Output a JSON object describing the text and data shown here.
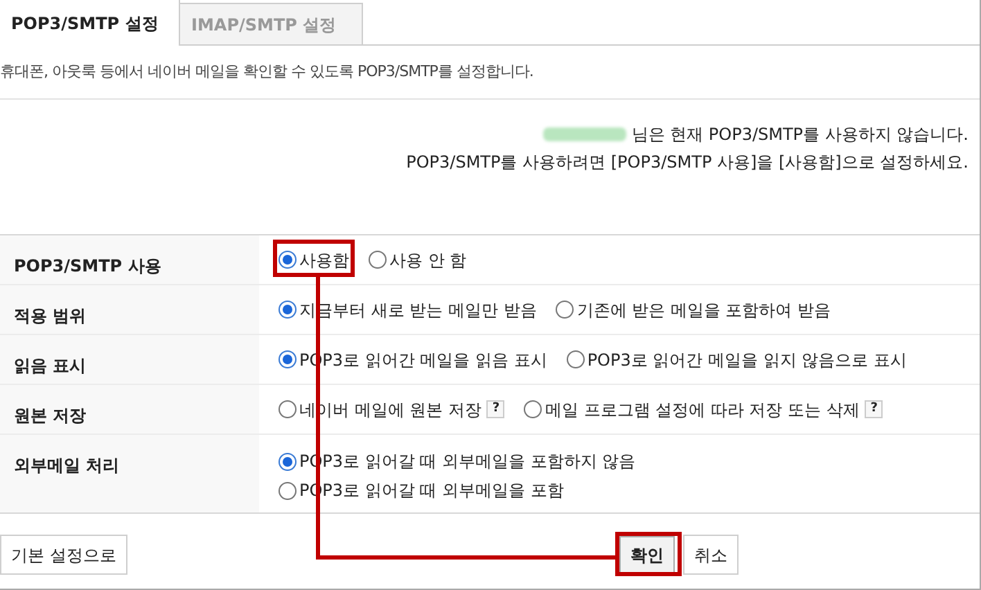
{
  "tabs": [
    {
      "label": "POP3/SMTP 설정",
      "selected": true
    },
    {
      "label": "IMAP/SMTP 설정",
      "selected": false
    }
  ],
  "description": "휴대폰, 아웃룩 등에서 네이버 메일을 확인할 수 있도록 POP3/SMTP를 설정합니다.",
  "notice": {
    "line_1": "님은 현재 POP3/SMTP를 사용하지 않습니다.",
    "line_2": "POP3/SMTP를 사용하려면 [POP3/SMTP 사용]을 [사용함]으로 설정하세요."
  },
  "settings": [
    {
      "label": "POP3/SMTP 사용",
      "kind": "inline",
      "options": [
        {
          "label": "사용함",
          "selected": true
        },
        {
          "label": "사용 안 함",
          "selected": false
        }
      ]
    },
    {
      "label": "적용 범위",
      "kind": "inline",
      "options": [
        {
          "label": "지금부터 새로 받는 메일만 받음",
          "selected": true
        },
        {
          "label": "기존에 받은 메일을 포함하여 받음",
          "selected": false
        }
      ]
    },
    {
      "label": "읽음 표시",
      "kind": "inline",
      "options": [
        {
          "label": "POP3로 읽어간 메일을 읽음 표시",
          "selected": true
        },
        {
          "label": "POP3로 읽어간 메일을 읽지 않음으로 표시",
          "selected": false
        }
      ]
    },
    {
      "label": "원본 저장",
      "kind": "inline",
      "options": [
        {
          "label": "네이버 메일에 원본 저장",
          "selected": false,
          "help": "?"
        },
        {
          "label": "메일 프로그램 설정에 따라 저장 또는 삭제",
          "selected": false,
          "help": "?"
        }
      ]
    },
    {
      "label": "외부메일 처리",
      "kind": "stacked",
      "options": [
        {
          "label": "POP3로 읽어갈 때 외부메일을 포함하지 않음",
          "selected": true
        },
        {
          "label": "POP3로 읽어갈 때 외부메일을 포함",
          "selected": false
        }
      ]
    }
  ],
  "buttons": {
    "reset": "기본 설정으로",
    "confirm": "확인",
    "cancel": "취소"
  }
}
